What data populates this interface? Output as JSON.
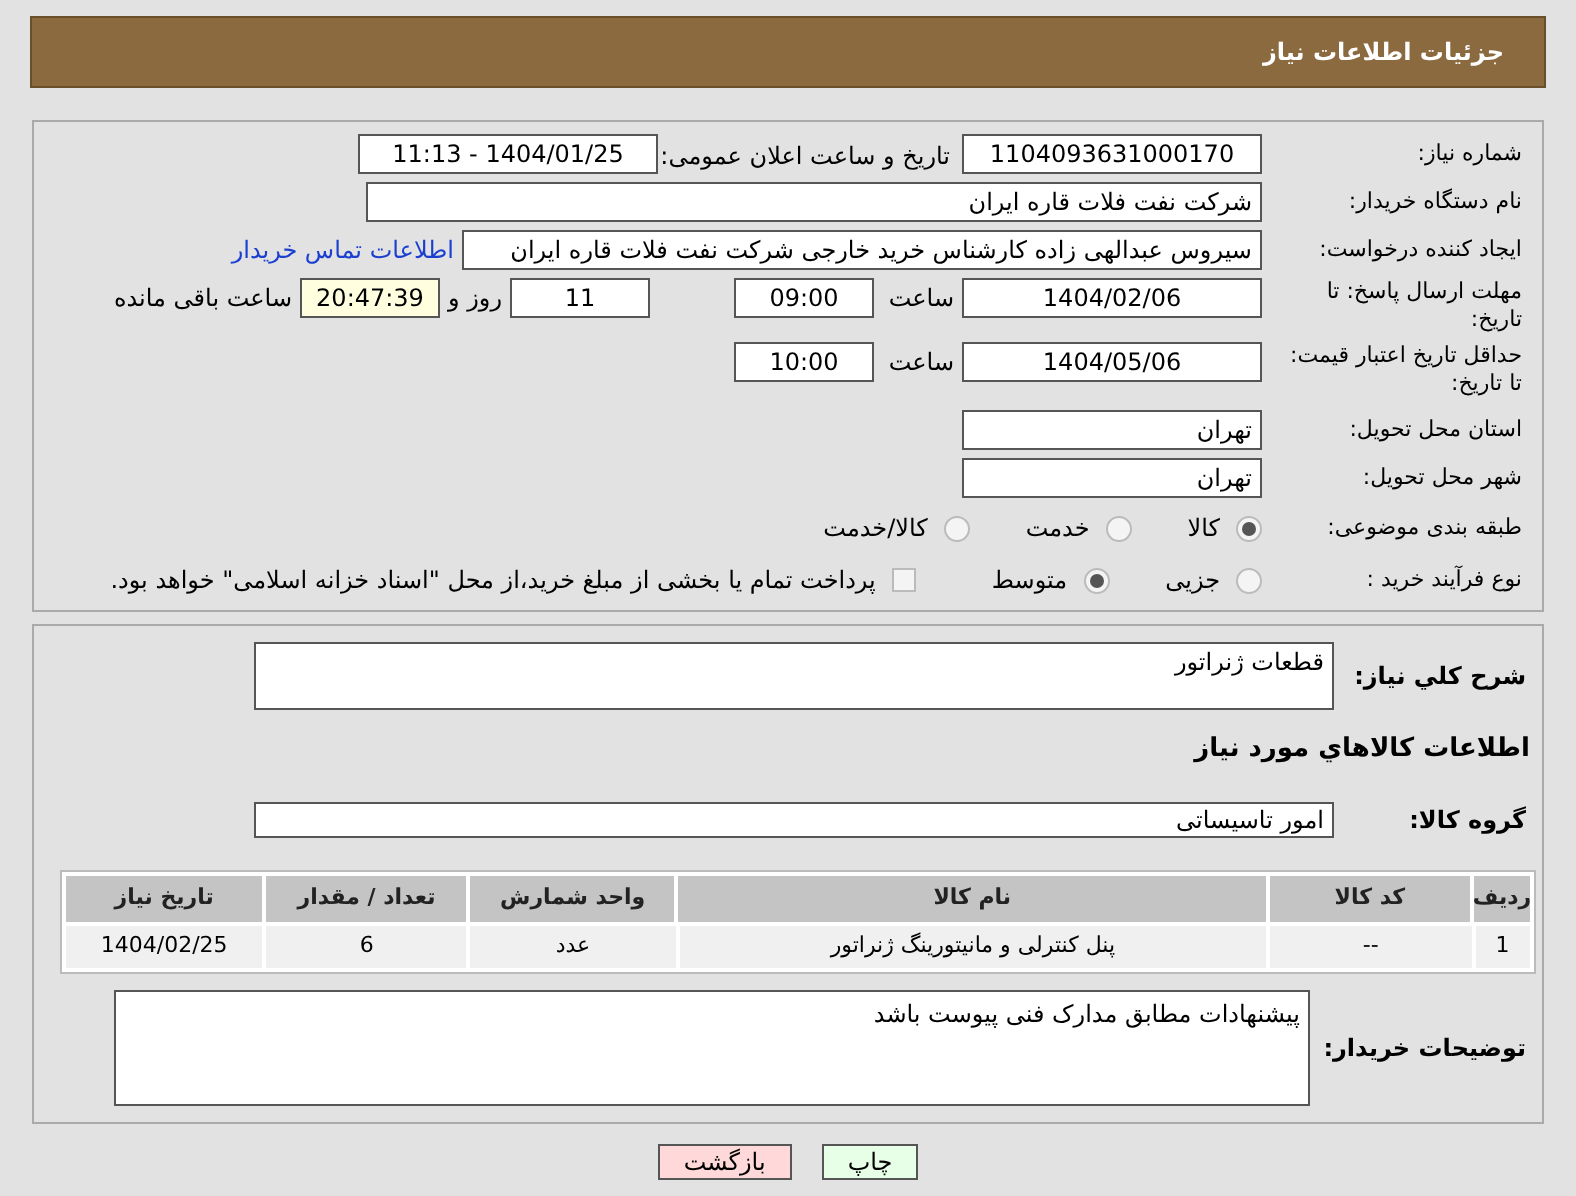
{
  "header": {
    "title": "جزئیات اطلاعات نیاز"
  },
  "need_number": {
    "label": "شماره نیاز:",
    "value": "1104093631000170"
  },
  "announce": {
    "label": "تاریخ و ساعت اعلان عمومی:",
    "value": "1404/01/25 - 11:13"
  },
  "buyer_org": {
    "label": "نام دستگاه خریدار:",
    "value": "شرکت نفت فلات قاره ایران"
  },
  "requester": {
    "label": "ایجاد کننده درخواست:",
    "value": "سیروس عبدالهی زاده کارشناس خرید خارجی شرکت نفت فلات قاره ایران",
    "link": "اطلاعات تماس خریدار"
  },
  "reply_deadline": {
    "label": "مهلت ارسال پاسخ: تا تاریخ:",
    "date": "1404/02/06",
    "time_label": "ساعت",
    "time": "09:00",
    "days": "11",
    "days_label": "روز و",
    "remaining": "20:47:39",
    "remaining_label": "ساعت باقی مانده"
  },
  "price_validity": {
    "label": "حداقل تاریخ اعتبار قیمت: تا تاریخ:",
    "date": "1404/05/06",
    "time_label": "ساعت",
    "time": "10:00"
  },
  "province": {
    "label": "استان محل تحویل:",
    "value": "تهران"
  },
  "city": {
    "label": "شهر محل تحویل:",
    "value": "تهران"
  },
  "category": {
    "label": "طبقه بندی موضوعی:",
    "options": [
      {
        "label": "کالا",
        "selected": true
      },
      {
        "label": "خدمت",
        "selected": false
      },
      {
        "label": "کالا/خدمت",
        "selected": false
      }
    ]
  },
  "process": {
    "label": "نوع فرآیند خرید :",
    "options": [
      {
        "label": "جزیی",
        "selected": false
      },
      {
        "label": "متوسط",
        "selected": true
      }
    ],
    "payment": {
      "label": "پرداخت تمام یا بخشی از مبلغ خرید،از محل \"اسناد خزانه اسلامی\" خواهد بود.",
      "checked": false
    }
  },
  "description": {
    "label": "شرح کلي نياز:",
    "value": "قطعات ژنراتور"
  },
  "goods_title": "اطلاعات کالاهاي مورد نياز",
  "goods_group": {
    "label": "گروه کالا:",
    "value": "امور تاسیساتی"
  },
  "table": {
    "columns": [
      "ردیف",
      "کد کالا",
      "نام کالا",
      "واحد شمارش",
      "تعداد / مقدار",
      "تاریخ نیاز"
    ],
    "rows": [
      [
        "1",
        "--",
        "پنل کنترلی و مانیتورینگ ژنراتور",
        "عدد",
        "6",
        "1404/02/25"
      ]
    ]
  },
  "buyer_notes": {
    "label": "توضیحات خریدار:",
    "value": "پیشنهادات مطابق مدارک فنی پیوست باشد"
  },
  "buttons": [
    {
      "label": "چاپ",
      "kind": "print"
    },
    {
      "label": "بازگشت",
      "kind": "back"
    }
  ]
}
